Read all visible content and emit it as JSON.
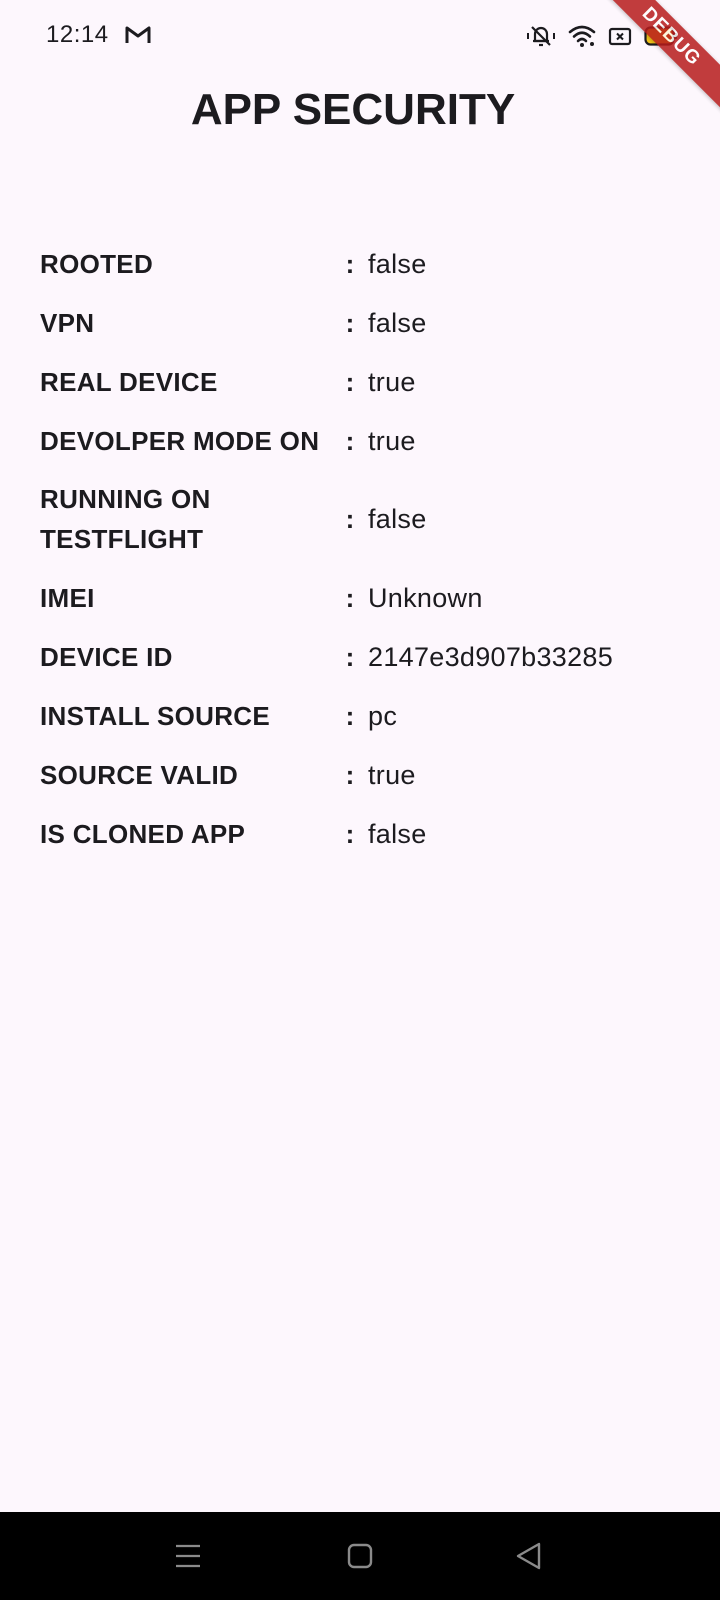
{
  "status_bar": {
    "time": "12:14",
    "icons": [
      "gmail-icon",
      "vibrate-silent-icon",
      "wifi-icon",
      "no-sim-icon",
      "battery-icon"
    ],
    "battery_color": "#f5c518"
  },
  "debug_banner": {
    "label": "DEBUG",
    "color": "#b71c1c"
  },
  "page": {
    "title": "APP SECURITY",
    "background": "#fdf7fd"
  },
  "rows": [
    {
      "label": "ROOTED",
      "separator": ":",
      "value": "false"
    },
    {
      "label": "VPN",
      "separator": ":",
      "value": "false"
    },
    {
      "label": "REAL DEVICE",
      "separator": ":",
      "value": "true"
    },
    {
      "label": "DEVOLPER MODE ON",
      "separator": ":",
      "value": "true"
    },
    {
      "label": "RUNNING ON TESTFLIGHT",
      "separator": ":",
      "value": "false"
    },
    {
      "label": "IMEI",
      "separator": ":",
      "value": "Unknown"
    },
    {
      "label": "DEVICE ID",
      "separator": ":",
      "value": "2147e3d907b33285"
    },
    {
      "label": "INSTALL SOURCE",
      "separator": ":",
      "value": "pc"
    },
    {
      "label": "SOURCE VALID",
      "separator": ":",
      "value": "true"
    },
    {
      "label": "IS CLONED APP",
      "separator": ":",
      "value": "false"
    }
  ],
  "nav_bar": {
    "buttons": [
      "menu-icon",
      "home-icon",
      "back-icon"
    ]
  }
}
